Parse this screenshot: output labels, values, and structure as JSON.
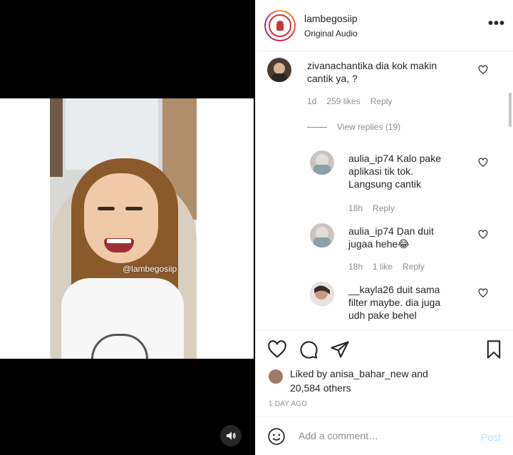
{
  "video": {
    "watermark": "@lambegosiip",
    "sound_icon": "speaker-icon"
  },
  "post": {
    "username": "lambegosiip",
    "audio": "Original Audio",
    "more_icon": "ellipsis-icon",
    "more_label": "•••"
  },
  "comments": [
    {
      "username": "zivanachantika",
      "text": "dia kok makin cantik ya, ?",
      "time": "1d",
      "likes": "259 likes",
      "reply": "Reply",
      "view_replies": "View replies (19)"
    },
    {
      "username": "aulia_ip74",
      "text": "Kalo pake aplikasi tik tok. Langsung cantik",
      "time": "18h",
      "reply": "Reply"
    },
    {
      "username": "aulia_ip74",
      "text": "Dan duit jugaa hehe😂",
      "time": "18h",
      "likes": "1 like",
      "reply": "Reply"
    },
    {
      "username": "__kayla26",
      "text": "duit sama filter maybe. dia juga udh pake behel"
    }
  ],
  "actions": {
    "like_icon": "heart-icon",
    "comment_icon": "comment-icon",
    "share_icon": "share-icon",
    "save_icon": "bookmark-icon"
  },
  "likes_summary": {
    "prefix": "Liked by ",
    "user": "anisa_bahar_new",
    "middle": " and",
    "others": "20,584 others"
  },
  "timestamp": "1 DAY AGO",
  "add_comment": {
    "placeholder": "Add a comment…",
    "post_label": "Post",
    "emoji_icon": "emoji-icon"
  },
  "colors": {
    "text": "#262626",
    "muted": "#8e8e8e",
    "post_disabled": "#b2dffc",
    "border": "#efefef"
  }
}
